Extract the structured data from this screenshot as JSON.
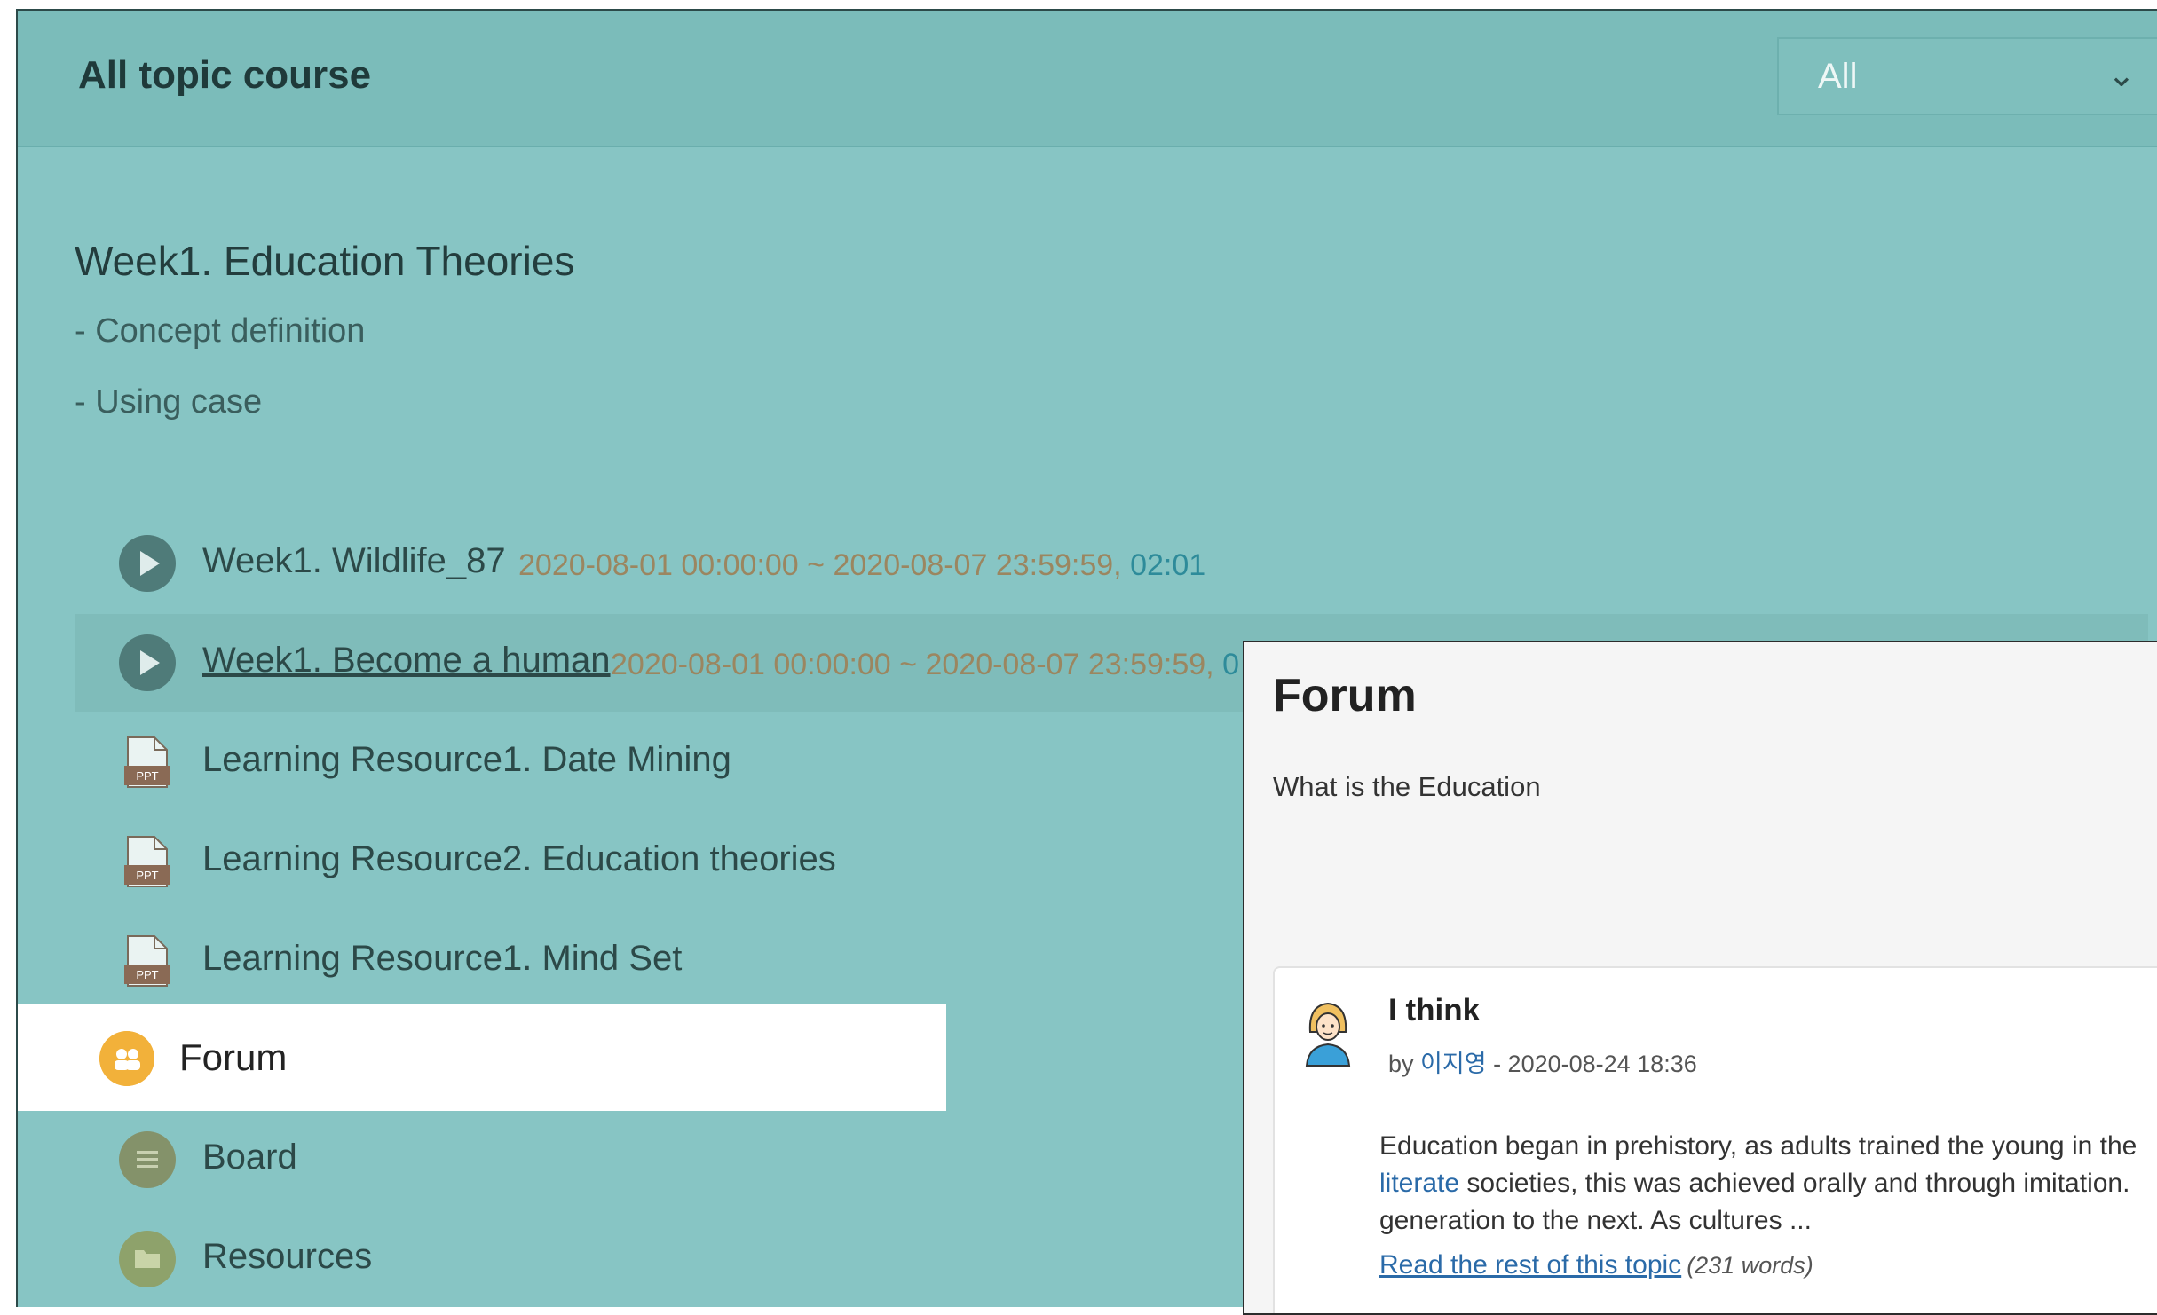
{
  "header": {
    "course_title": "All topic course",
    "filter_value": "All"
  },
  "section": {
    "title": "Week1. Education Theories",
    "desc": [
      "- Concept definition",
      "- Using case"
    ]
  },
  "activities": [
    {
      "label": "Week1. Wildlife_87",
      "date": "2020-08-01 00:00:00 ~ 2020-08-07 23:59:59, ",
      "duration": "02:01",
      "icon": "play-icon"
    },
    {
      "label": "Week1. Become a human",
      "date": "2020-08-01 00:00:00 ~ 2020-08-07 23:59:59, ",
      "duration": "0",
      "icon": "play-icon"
    },
    {
      "label": "Learning Resource1. Date Mining",
      "icon": "ppt-file-icon"
    },
    {
      "label": "Learning Resource2. Education theories",
      "icon": "ppt-file-icon"
    },
    {
      "label": "Learning Resource1. Mind Set",
      "icon": "ppt-file-icon"
    },
    {
      "label": "Forum",
      "icon": "forum-icon"
    },
    {
      "label": "Board",
      "icon": "board-icon"
    },
    {
      "label": "Resources",
      "icon": "folder-icon"
    }
  ],
  "ppt_badge": "PPT",
  "popup": {
    "title": "Forum",
    "question": "What is the Education",
    "post": {
      "subject": "I think",
      "by": "by ",
      "author": "이지영",
      "date": " - 2020-08-24 18:36",
      "body_line1": "Education began in prehistory, as adults trained the young in the",
      "body_line2_link": "literate",
      "body_line2_rest": " societies, this was achieved orally and through imitation.",
      "body_line3": "generation to the next. As cultures ...",
      "read_more": "Read the rest of this topic",
      "word_count": "(231 words)"
    }
  },
  "colors": {
    "background": "#87c5c4",
    "header": "#7bbcba",
    "forum_icon": "#f2b13a",
    "link": "#2a6aa8"
  }
}
